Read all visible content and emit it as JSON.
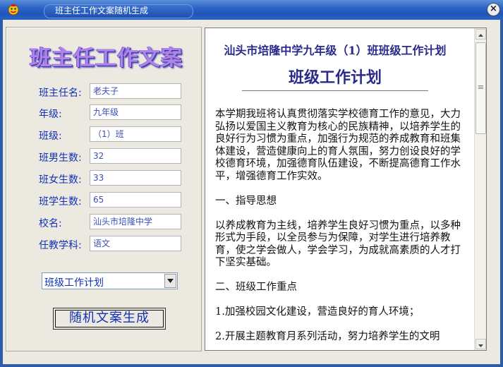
{
  "window": {
    "title": "班主任工作文案随机生成",
    "close_label": "×"
  },
  "logo": {
    "text": "班主任工作文案"
  },
  "form": {
    "fields": [
      {
        "label": "班主任名:",
        "value": "老夫子"
      },
      {
        "label": "年级:",
        "value": "九年级"
      },
      {
        "label": "班级:",
        "value": "（1）班"
      },
      {
        "label": "班男生数:",
        "value": "32"
      },
      {
        "label": "班女生数:",
        "value": "33"
      },
      {
        "label": "班学生数:",
        "value": "65"
      },
      {
        "label": "校名:",
        "value": "汕头市培隆中学"
      },
      {
        "label": "任教学科:",
        "value": "语文"
      }
    ],
    "doc_type": "班级工作计划",
    "generate_label": "随机文案生成"
  },
  "document": {
    "header": "汕头市培隆中学九年级（1）班班级工作计划",
    "title": "班级工作计划",
    "paragraphs": [
      "本学期我班将认真贯彻落实学校德育工作的意见，大力弘扬以爱国主义教育为核心的民族精神，以培养学生的良好行为习惯为重点，加强行为规范的养成教育和班集体建设，营造健康向上的育人氛围，努力创设良好的学校德育环境，加强德育队伍建设，不断提高德育工作水平，增强德育工作实效。",
      "一、指导思想",
      "以养成教育为主线，培养学生良好习惯为重点，以多种形式为手段，以全员参与为保障，对学生进行培养教育，使之学会做人，学会学习，为成就高素质的人才打下坚实基础。",
      "二、班级工作重点",
      "1.加强校园文化建设，营造良好的育人环境；",
      "2.开展主题教育月系列活动，努力培养学生的文明"
    ]
  }
}
